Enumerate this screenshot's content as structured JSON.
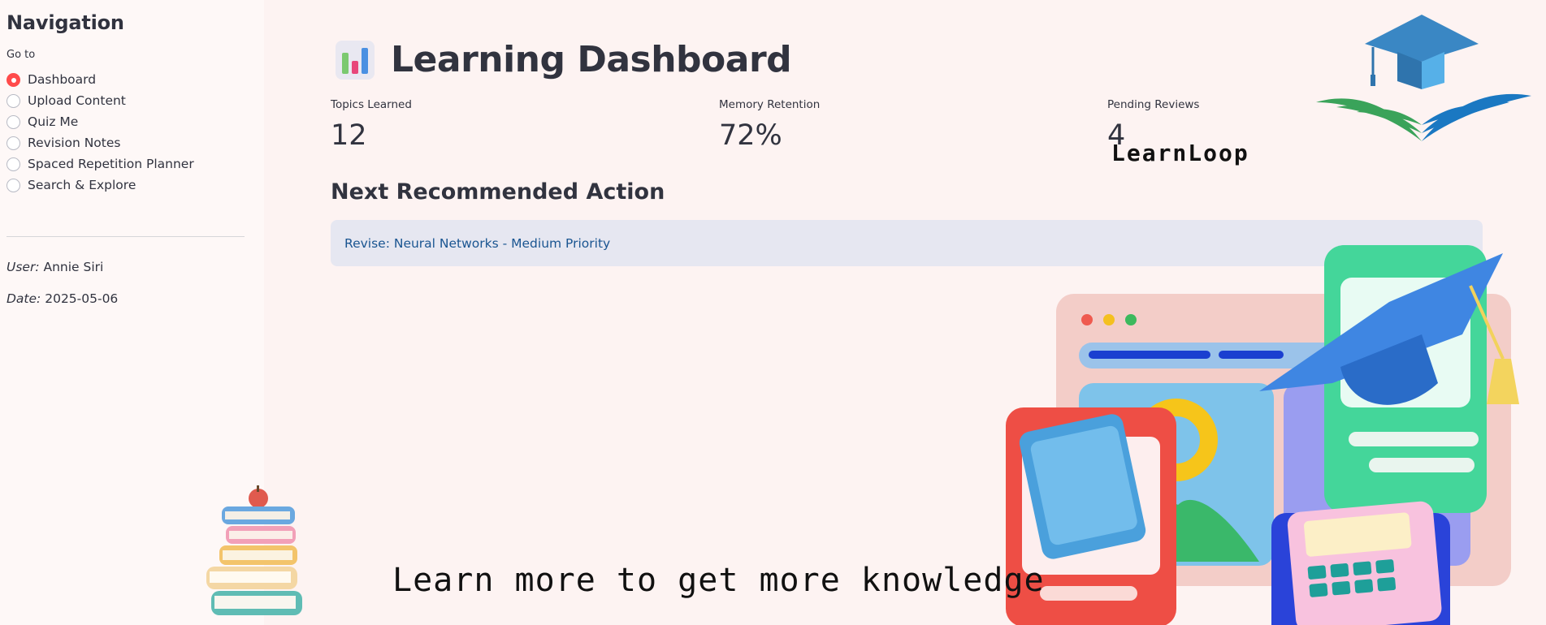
{
  "sidebar": {
    "title": "Navigation",
    "radio_label": "Go to",
    "options": [
      {
        "label": "Dashboard",
        "selected": true
      },
      {
        "label": "Upload Content",
        "selected": false
      },
      {
        "label": "Quiz Me",
        "selected": false
      },
      {
        "label": "Revision Notes",
        "selected": false
      },
      {
        "label": "Spaced Repetition Planner",
        "selected": false
      },
      {
        "label": "Search & Explore",
        "selected": false
      }
    ],
    "user_key": "User:",
    "user_value": "Annie Siri",
    "date_key": "Date:",
    "date_value": "2025-05-06"
  },
  "main": {
    "title": "Learning Dashboard",
    "title_icon": "bar-chart-icon",
    "metrics": [
      {
        "label": "Topics Learned",
        "value": "12"
      },
      {
        "label": "Memory Retention",
        "value": "72%"
      },
      {
        "label": "Pending Reviews",
        "value": "4"
      }
    ],
    "section_heading": "Next Recommended Action",
    "alert_text": "Revise: Neural Networks - Medium Priority",
    "logo_text": "LearnLoop",
    "tagline": "Learn more to get more knowledge"
  },
  "colors": {
    "accent": "#ff4b4b",
    "background": "#fdf3f2",
    "sidebar_bg": "#fef8f7",
    "alert_bg": "#e6e7f1",
    "alert_text": "#1a5591"
  }
}
